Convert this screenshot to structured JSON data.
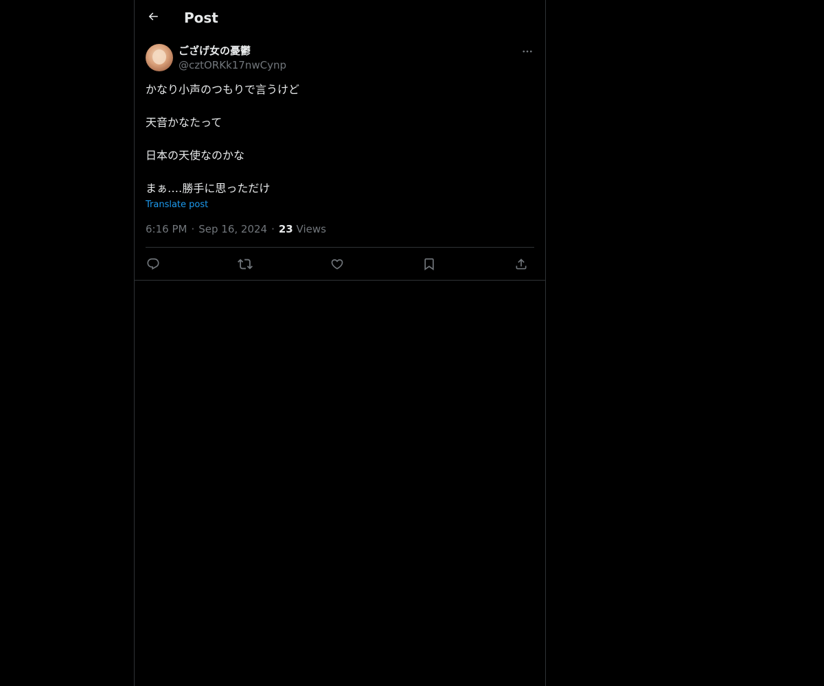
{
  "header": {
    "back_icon": "arrow-left-icon",
    "title": "Post"
  },
  "author": {
    "display_name": "ござげ女の憂鬱",
    "handle": "@cztORKk17nwCynp",
    "more_icon": "more-horizontal-icon"
  },
  "post": {
    "lines": [
      "かなり小声のつもりで言うけど",
      "",
      "天音かなたって",
      "",
      "日本の天使なのかな",
      "",
      "まぁ‥‥勝手に思っただけ"
    ],
    "translate_label": "Translate post"
  },
  "meta": {
    "time": "6:16 PM",
    "separator": "·",
    "date": "Sep 16, 2024",
    "views_count": "23",
    "views_label": "Views"
  },
  "actions": {
    "icons": [
      "reply-icon",
      "repost-icon",
      "like-icon",
      "bookmark-icon",
      "share-icon"
    ]
  },
  "colors": {
    "background": "#000000",
    "border": "#2f3336",
    "text_primary": "#e7e9ea",
    "text_secondary": "#71767b",
    "accent": "#1d9bf0"
  }
}
